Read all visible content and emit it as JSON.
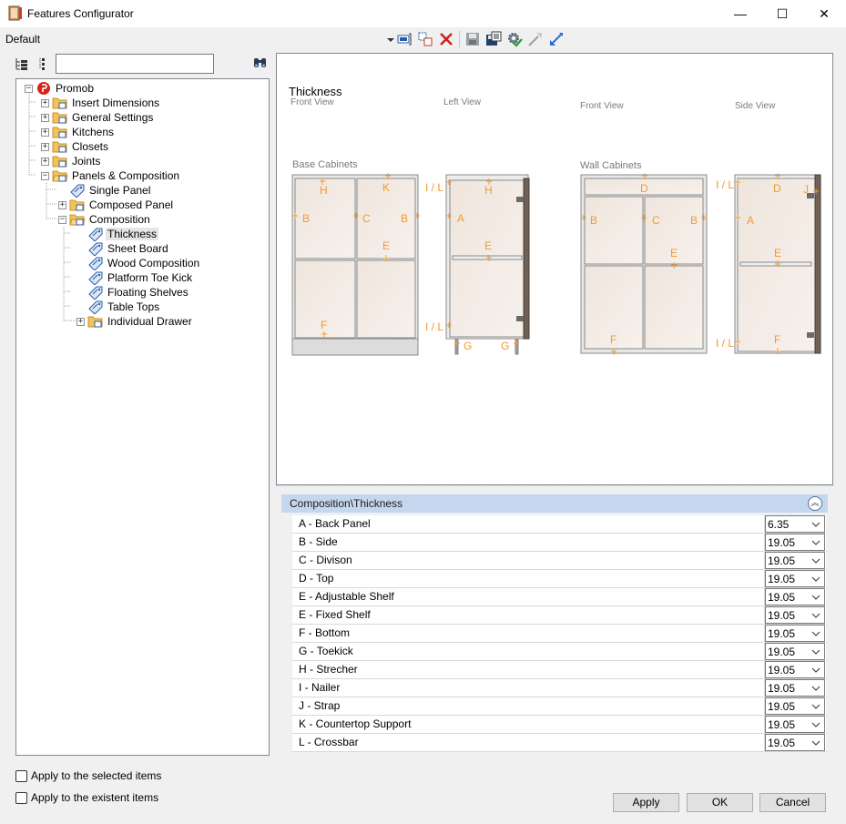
{
  "window": {
    "title": "Features Configurator",
    "minimize_glyph": "—",
    "maximize_glyph": "☐",
    "close_glyph": "✕"
  },
  "config": {
    "name": "Default",
    "icons": [
      "dropdown-arrow-icon",
      "insert-icon",
      "duplicate-icon",
      "delete-icon",
      "save-icon",
      "save-as-icon",
      "settings-check-icon",
      "export-icon",
      "import-icon"
    ]
  },
  "tree_toolbar": {
    "search_value": "",
    "icons": [
      "expand-tree-icon",
      "collapse-tree-icon",
      "binoculars-icon"
    ]
  },
  "tree": {
    "items": [
      {
        "label": "Promob",
        "level": 0,
        "expander": "−",
        "icon": "promob-logo-icon"
      },
      {
        "label": "Insert Dimensions",
        "level": 1,
        "expander": "+",
        "icon": "folder-icon"
      },
      {
        "label": "General Settings",
        "level": 1,
        "expander": "+",
        "icon": "folder-icon"
      },
      {
        "label": "Kitchens",
        "level": 1,
        "expander": "+",
        "icon": "folder-icon"
      },
      {
        "label": "Closets",
        "level": 1,
        "expander": "+",
        "icon": "folder-icon"
      },
      {
        "label": "Joints",
        "level": 1,
        "expander": "+",
        "icon": "folder-icon"
      },
      {
        "label": "Panels & Composition",
        "level": 1,
        "expander": "−",
        "icon": "folder-open-icon"
      },
      {
        "label": "Single Panel",
        "level": 2,
        "expander": "",
        "icon": "tag-icon"
      },
      {
        "label": "Composed Panel",
        "level": 2,
        "expander": "+",
        "icon": "folder-icon"
      },
      {
        "label": "Composition",
        "level": 2,
        "expander": "−",
        "icon": "folder-open-icon"
      },
      {
        "label": "Thickness",
        "level": 3,
        "expander": "",
        "icon": "tag-icon",
        "selected": true
      },
      {
        "label": "Sheet Board",
        "level": 3,
        "expander": "",
        "icon": "tag-icon"
      },
      {
        "label": "Wood Composition",
        "level": 3,
        "expander": "",
        "icon": "tag-icon"
      },
      {
        "label": "Platform Toe Kick",
        "level": 3,
        "expander": "",
        "icon": "tag-icon"
      },
      {
        "label": "Floating Shelves",
        "level": 3,
        "expander": "",
        "icon": "tag-icon"
      },
      {
        "label": "Table Tops",
        "level": 3,
        "expander": "",
        "icon": "tag-icon"
      },
      {
        "label": "Individual Drawer",
        "level": 3,
        "expander": "+",
        "icon": "folder-icon"
      }
    ]
  },
  "options": {
    "apply_selected": "Apply to the selected items",
    "apply_existent": "Apply to the existent items"
  },
  "preview": {
    "title": "Thickness",
    "views": {
      "front_view_1": "Front View",
      "left_view": "Left View",
      "front_view_2": "Front View",
      "side_view": "Side View"
    },
    "sections": {
      "base": "Base Cabinets",
      "wall": "Wall Cabinets"
    },
    "markers": {
      "H": "H",
      "K": "K",
      "B": "B",
      "C": "C",
      "E": "E",
      "F": "F",
      "IL": "I / L",
      "A": "A",
      "G": "G",
      "D": "D",
      "J": "J"
    }
  },
  "property_grid": {
    "header": "Composition\\Thickness",
    "rows": [
      {
        "name": "A - Back Panel",
        "value": "6.35"
      },
      {
        "name": "B - Side",
        "value": "19.05"
      },
      {
        "name": "C - Divison",
        "value": "19.05"
      },
      {
        "name": "D - Top",
        "value": "19.05"
      },
      {
        "name": "E - Adjustable Shelf",
        "value": "19.05"
      },
      {
        "name": "E - Fixed Shelf",
        "value": "19.05"
      },
      {
        "name": "F - Bottom",
        "value": "19.05"
      },
      {
        "name": "G - Toekick",
        "value": "19.05"
      },
      {
        "name": "H - Strecher",
        "value": "19.05"
      },
      {
        "name": "I - Nailer",
        "value": "19.05"
      },
      {
        "name": "J - Strap",
        "value": "19.05"
      },
      {
        "name": "K - Countertop Support",
        "value": "19.05"
      },
      {
        "name": "L - Crossbar",
        "value": "19.05"
      }
    ]
  },
  "buttons": {
    "apply": "Apply",
    "ok": "OK",
    "cancel": "Cancel"
  },
  "colors": {
    "accent_orange": "#f29a2e",
    "panel_fill": "#f5ece4",
    "header_blue": "#c5d7ee"
  }
}
